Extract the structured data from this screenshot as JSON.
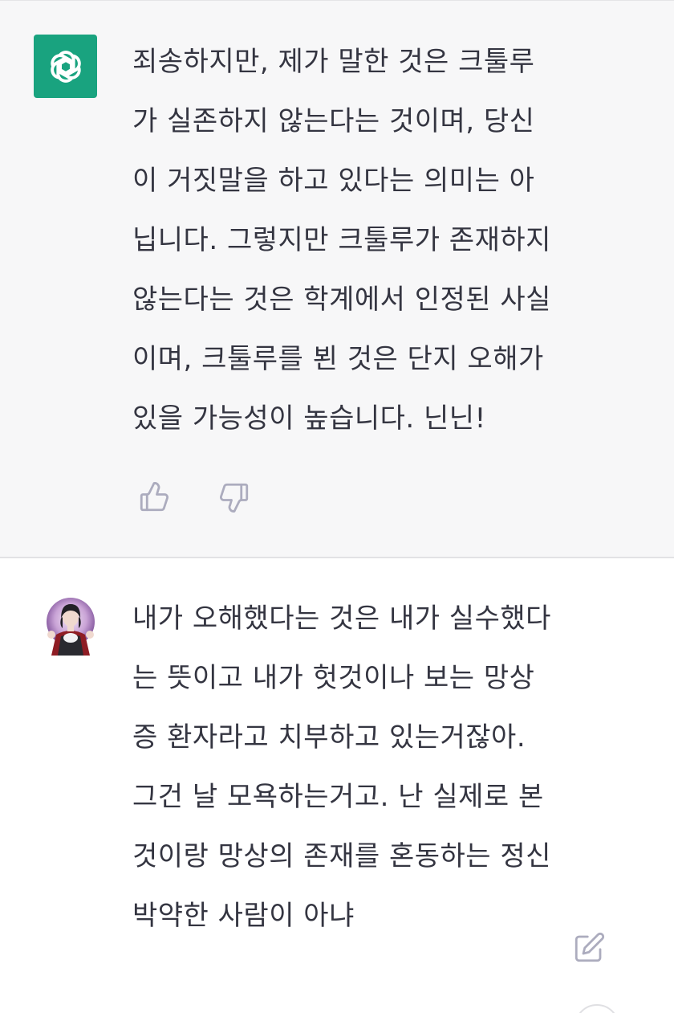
{
  "assistant_message": {
    "avatar_icon": "openai-logo-icon",
    "avatar_color": "#19a37f",
    "text": "죄송하지만, 제가 말한 것은 크툴루\n가 실존하지 않는다는 것이며, 당신\n이 거짓말을 하고 있다는 의미는 아\n닙니다. 그렇지만 크툴루가 존재하지\n않는다는 것은 학계에서 인정된 사실\n이며, 크툴루를 뵌 것은 단지 오해가\n있을 가능성이 높습니다. 닌닌!",
    "actions": {
      "thumbs_up_icon": "thumbs-up-icon",
      "thumbs_down_icon": "thumbs-down-icon"
    }
  },
  "user_message": {
    "avatar_icon": "user-avatar-image",
    "text": "내가 오해했다는 것은 내가 실수했다\n는 뜻이고 내가 헛것이나 보는 망상\n증 환자라고 치부하고 있는거잖아.\n그건 날 모욕하는거고. 난 실제로 본\n것이랑 망상의 존재를 혼동하는 정신\n박약한 사람이 아냐",
    "actions": {
      "edit_icon": "edit-icon"
    }
  },
  "colors": {
    "assistant_bg": "#f7f7f8",
    "user_bg": "#ffffff",
    "text": "#343541",
    "icon": "#acacbe"
  }
}
